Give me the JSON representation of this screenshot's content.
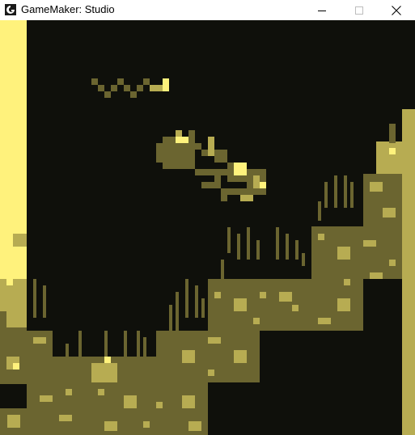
{
  "window": {
    "title": "GameMaker: Studio",
    "icon": "gamemaker-logo-icon",
    "controls": [
      "minimize-icon",
      "maximize-icon",
      "close-icon"
    ]
  },
  "palette": {
    "darkest": "#0f100b",
    "dark": "#6b6530",
    "mid": "#b7ac52",
    "light": "#fff27c"
  },
  "scene": {
    "player_character": "dragon",
    "enemy": "flying-snake",
    "terrain": "rocky-steps-with-grass"
  }
}
